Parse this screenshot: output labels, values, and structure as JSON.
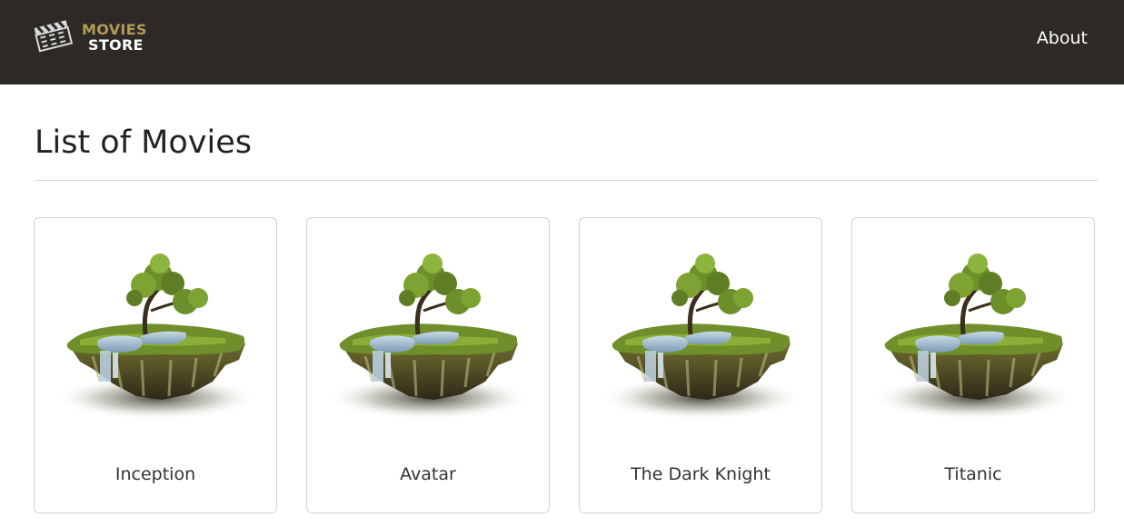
{
  "app": {
    "brand_line1": "MOVIES",
    "brand_line2": "STORE",
    "logo_icon": "film-clapperboard-icon"
  },
  "nav": {
    "about_label": "About"
  },
  "main": {
    "title": "List of Movies",
    "movies": [
      {
        "title": "Inception",
        "image": "floating-island-tree-image"
      },
      {
        "title": "Avatar",
        "image": "floating-island-tree-image"
      },
      {
        "title": "The Dark Knight",
        "image": "floating-island-tree-image"
      },
      {
        "title": "Titanic",
        "image": "floating-island-tree-image"
      }
    ]
  },
  "colors": {
    "navbar_bg": "#2d2a26",
    "brand_gold": "#b39a55",
    "card_border": "#d3d3d3"
  }
}
